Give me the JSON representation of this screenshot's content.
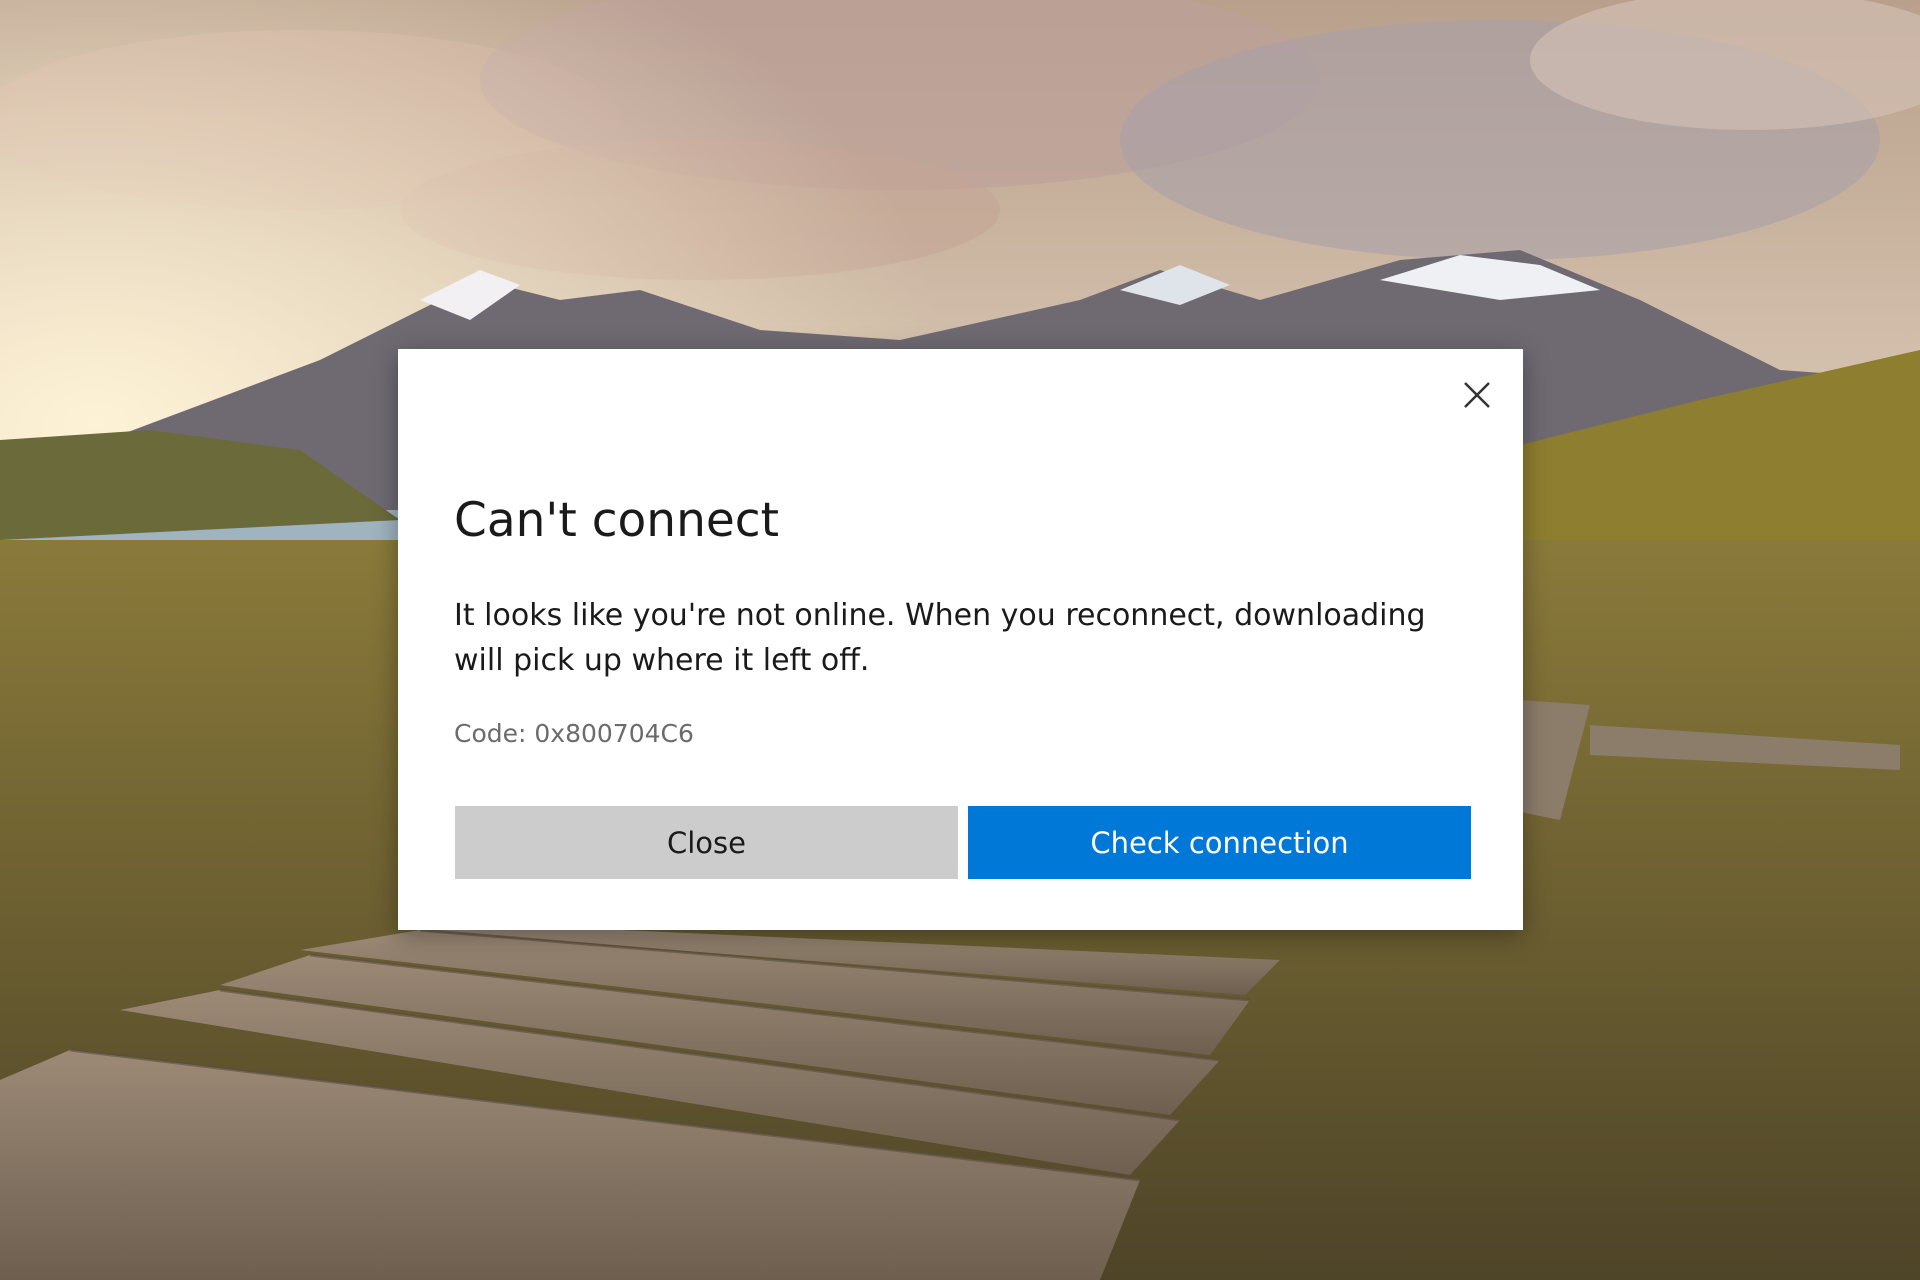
{
  "dialog": {
    "title": "Can't connect",
    "message": "It looks like you're not online. When you reconnect, downloading will pick up where it left off.",
    "code": "Code: 0x800704C6",
    "close_button_label": "Close",
    "check_button_label": "Check connection",
    "close_icon": "close-icon"
  },
  "colors": {
    "dialog_background": "#ffffff",
    "primary_button": "#0078d7",
    "secondary_button": "#cccccc",
    "code_text": "#6b6b6b"
  }
}
